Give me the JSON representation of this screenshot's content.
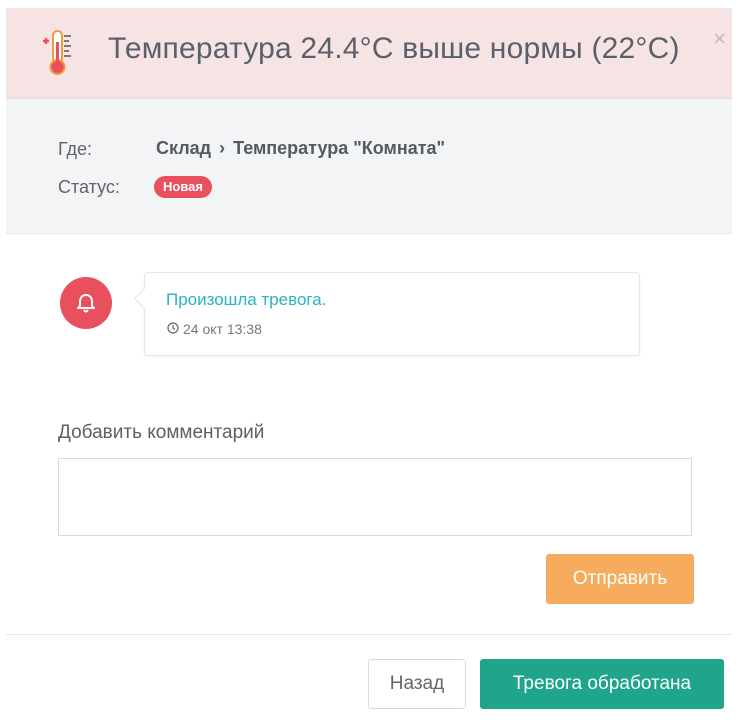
{
  "header": {
    "title": "Температура 24.4°C выше нормы (22°C)",
    "close": "×",
    "icon": "thermometer-icon",
    "color": "#f5e4e3"
  },
  "info": {
    "where_label": "Где:",
    "where_location": "Склад",
    "where_separator": "›",
    "where_sensor": "Температура \"Комната\"",
    "status_label": "Статус:",
    "status_value": "Новая",
    "status_color": "#e8505e"
  },
  "timeline": {
    "icon": "bell-icon",
    "event_text": "Произошла тревога.",
    "event_time": "24 окт 13:38",
    "time_icon": "clock-icon"
  },
  "comment": {
    "label": "Добавить комментарий",
    "value": "",
    "placeholder": "",
    "send_label": "Отправить"
  },
  "footer": {
    "back_label": "Назад",
    "done_label": "Тревога обработана"
  }
}
